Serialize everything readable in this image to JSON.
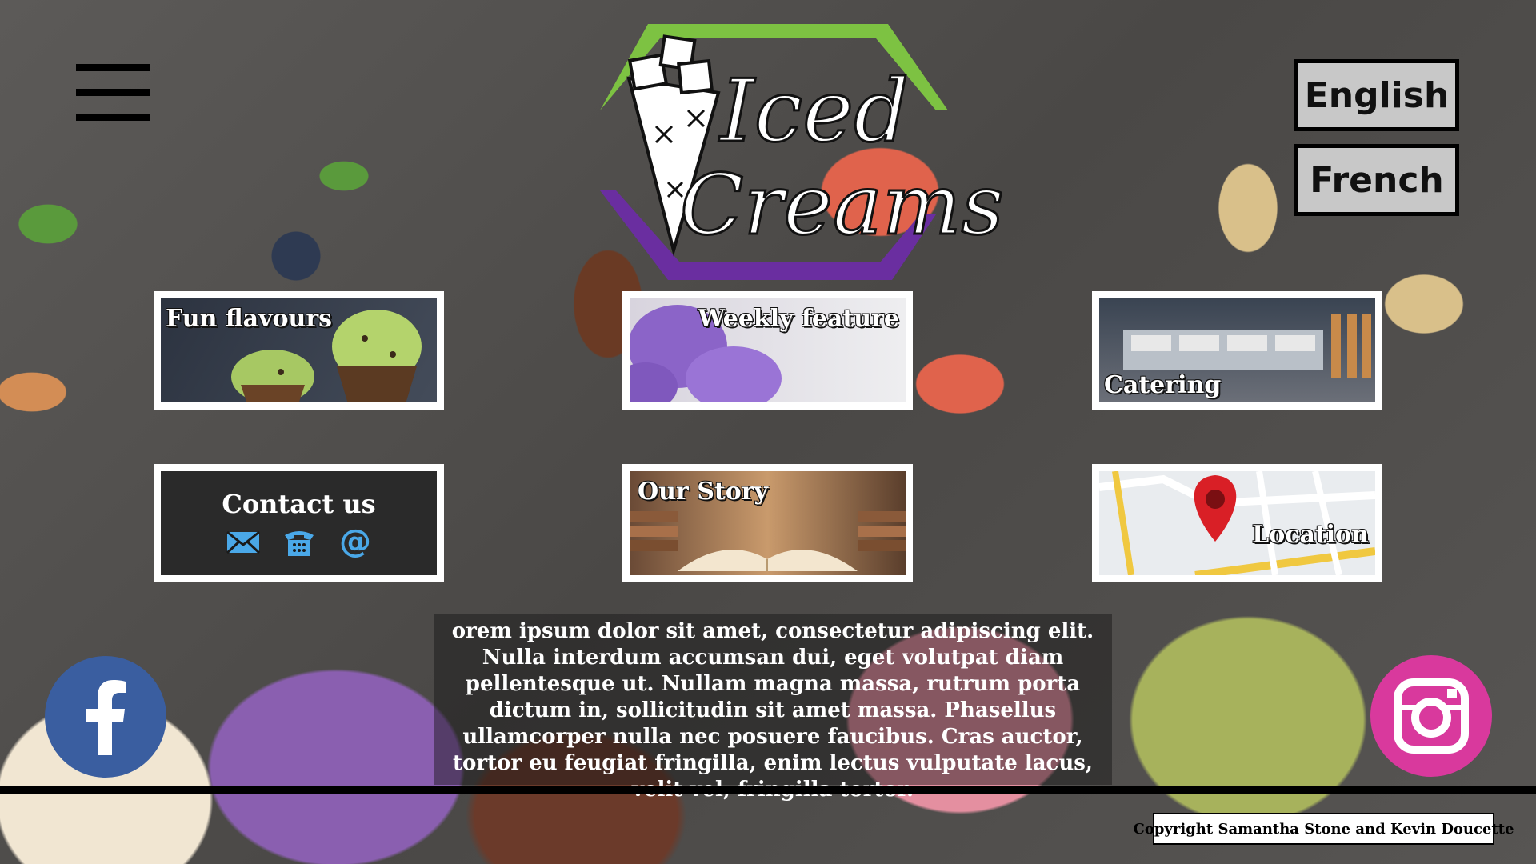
{
  "header": {
    "menu_icon": "hamburger-menu-icon",
    "logo_text_line1": "Iced",
    "logo_text_line2": "Creams",
    "languages": [
      "English",
      "French"
    ]
  },
  "tiles": [
    {
      "label": "Fun flavours"
    },
    {
      "label": "Weekly feature"
    },
    {
      "label": "Catering"
    },
    {
      "label": "Contact us",
      "icons": [
        "email-icon",
        "phone-icon",
        "at-sign-icon"
      ]
    },
    {
      "label": "Our Story"
    },
    {
      "label": "Location"
    }
  ],
  "description": "orem ipsum dolor sit amet, consectetur adipiscing elit. Nulla interdum accumsan dui, eget volutpat diam pellentesque ut. Nullam magna massa, rutrum porta dictum in, sollicitudin sit amet massa. Phasellus ullamcorper nulla nec posuere faucibus. Cras auctor, tortor eu feugiat fringilla, enim lectus vulputate lacus, velit vel, fringilla tortor.",
  "social": [
    "facebook-icon",
    "instagram-icon"
  ],
  "footer": {
    "copyright": "Copyright Samantha Stone and Kevin Doucette"
  },
  "colors": {
    "accent_green": "#7dc242",
    "accent_purple": "#6a2ea0",
    "facebook": "#3a5ea0",
    "instagram": "#d9399d"
  }
}
